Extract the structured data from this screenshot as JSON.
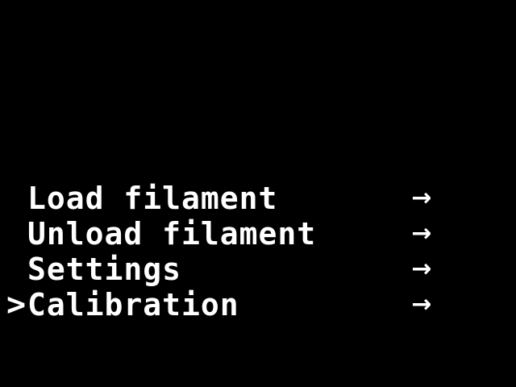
{
  "colors": {
    "background": "#000000",
    "foreground": "#ffffff"
  },
  "menu": {
    "cursor": ">",
    "items": [
      {
        "label": "Load filament",
        "arrow": "→",
        "selected": false
      },
      {
        "label": "Unload filament",
        "arrow": "→",
        "selected": false
      },
      {
        "label": "Settings",
        "arrow": "→",
        "selected": false
      },
      {
        "label": "Calibration",
        "arrow": "→",
        "selected": true
      }
    ]
  }
}
